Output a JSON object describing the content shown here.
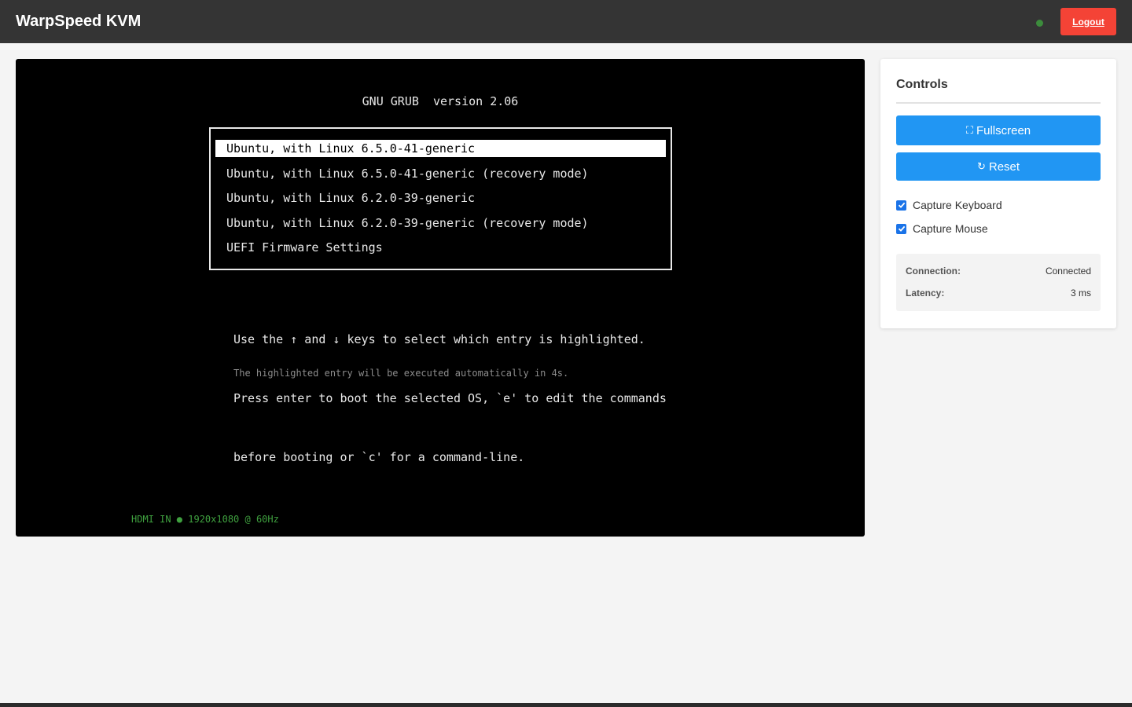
{
  "header": {
    "title": "WarpSpeed KVM",
    "status_color": "#3c8c3c",
    "logout_label": "Logout"
  },
  "screen": {
    "grub_title": "GNU GRUB  version 2.06",
    "entries": [
      "Ubuntu, with Linux 6.5.0-41-generic",
      "Ubuntu, with Linux 6.5.0-41-generic (recovery mode)",
      "Ubuntu, with Linux 6.2.0-39-generic",
      "Ubuntu, with Linux 6.2.0-39-generic (recovery mode)",
      "UEFI Firmware Settings"
    ],
    "selected_index": 0,
    "help_lines": [
      "Use the ↑ and ↓ keys to select which entry is highlighted.",
      "Press enter to boot the selected OS, `e' to edit the commands",
      "before booting or `c' for a command-line."
    ],
    "countdown": "The highlighted entry will be executed automatically in 4s.",
    "hdmi_status": "HDMI IN ● 1920x1080 @ 60Hz"
  },
  "controls": {
    "title": "Controls",
    "fullscreen_icon": "⛶",
    "fullscreen_label": "Fullscreen",
    "reset_icon": "↻",
    "reset_label": "Reset",
    "capture_keyboard_label": "Capture Keyboard",
    "capture_keyboard_checked": true,
    "capture_mouse_label": "Capture Mouse",
    "capture_mouse_checked": true,
    "connection_label": "Connection:",
    "connection_value": "Connected",
    "latency_label": "Latency:",
    "latency_value": "3 ms"
  },
  "colors": {
    "accent": "#2196f3",
    "danger": "#f44336",
    "header_bg": "#343434",
    "hdmi_green": "#3fa03f"
  }
}
